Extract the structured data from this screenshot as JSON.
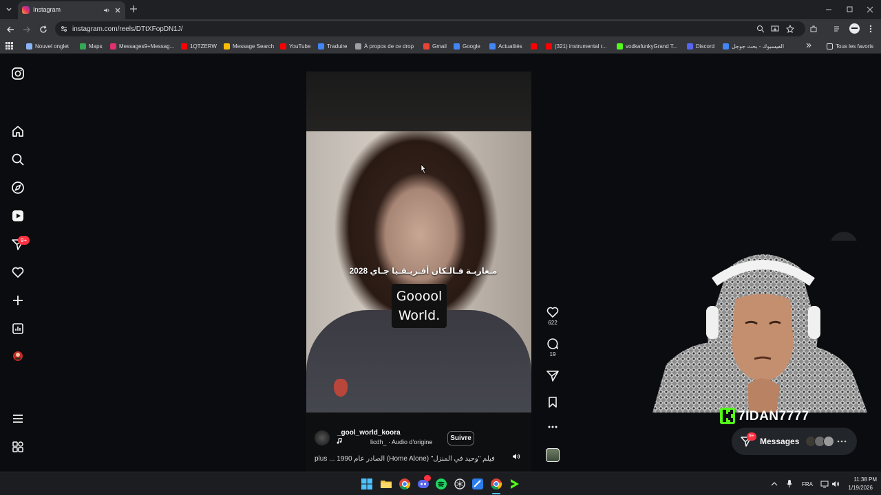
{
  "browser": {
    "tab_title": "Instagram",
    "url": "instagram.com/reels/DTtXFopDN1J/",
    "bookmarks": [
      {
        "label": "Nouvel onglet",
        "color": "#8ab4f8"
      },
      {
        "label": "Maps",
        "color": "#34a853"
      },
      {
        "label": "Messages9+Messag...",
        "color": "#e1306c"
      },
      {
        "label": "1QTZERW",
        "color": "#ff0000"
      },
      {
        "label": "Message Search",
        "color": "#fbbc04"
      },
      {
        "label": "YouTube",
        "color": "#ff0000"
      },
      {
        "label": "Traduire",
        "color": "#4285f4"
      },
      {
        "label": "À propos de ce drop",
        "color": "#9aa0a6"
      },
      {
        "label": "Gmail",
        "color": "#ea4335"
      },
      {
        "label": "Google",
        "color": "#4285f4"
      },
      {
        "label": "Actualités",
        "color": "#4285f4"
      },
      {
        "label": "",
        "color": "#ff0000"
      },
      {
        "label": "(321) instrumental r...",
        "color": "#ff0000"
      },
      {
        "label": "vodkafunkyGrand T...",
        "color": "#53fc18"
      },
      {
        "label": "Discord",
        "color": "#5865f2"
      },
      {
        "label": "الفيسبوك - بحث جوجل",
        "color": "#4285f4"
      }
    ],
    "all_bookmarks": "Tous les favoris"
  },
  "sidebar": {
    "notifications_badge": "9+"
  },
  "reel": {
    "arabic_caption": "مـغاربـة فـالـكان أفـريـقـيا جـاي 2028",
    "overlay_text_line1": "Gooool",
    "overlay_text_line2": "World.",
    "username": "_gool_world_koora",
    "audio": "licdh_ · Audio d'origine",
    "follow_label": "Suivre",
    "caption": "فيلم \"وحيد في المنزل\" (Home Alone) الصادر عام 1990 ... plus",
    "likes": "622",
    "comments": "19"
  },
  "overlay": {
    "streamer_name": "7IDAN7777",
    "messages_label": "Messages",
    "messages_badge": "9+"
  },
  "taskbar": {
    "language": "FRA",
    "time": "11:38 PM",
    "date": "1/19/2026"
  },
  "colors": {
    "accent_red": "#ff3040",
    "kick_green": "#53fc18"
  }
}
